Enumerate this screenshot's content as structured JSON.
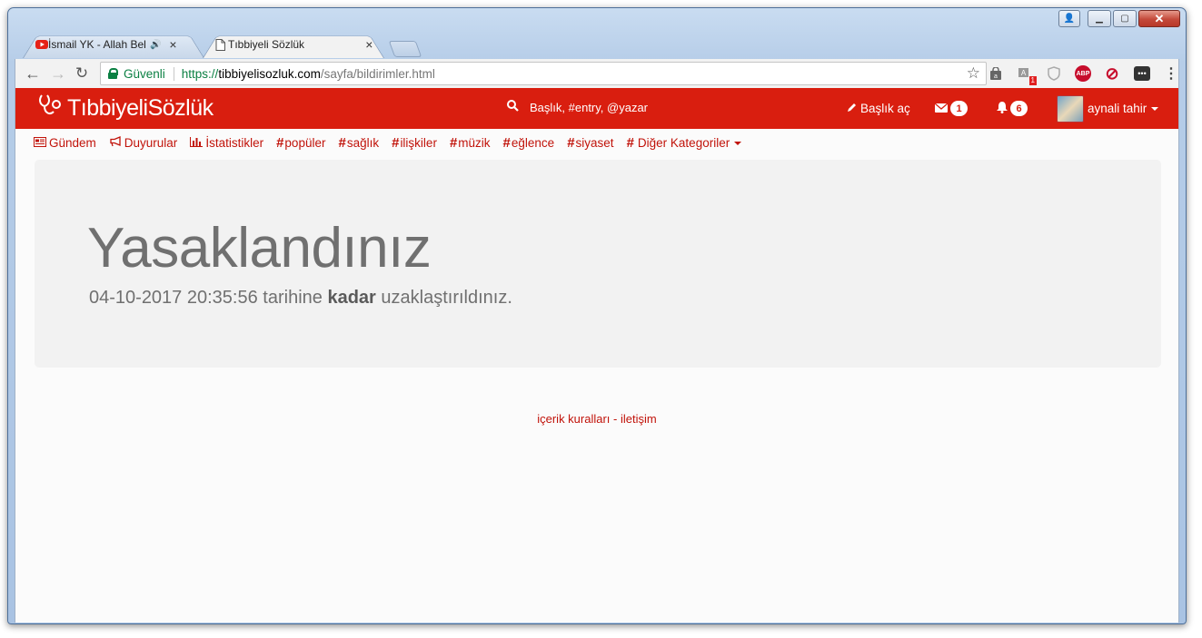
{
  "browser": {
    "tabs": [
      {
        "title": "İsmail YK - Allah Belan",
        "playing_audio": true,
        "favicon": "youtube-icon",
        "active": false
      },
      {
        "title": "Tıbbiyeli Sözlük",
        "favicon": "page-icon",
        "active": true
      }
    ],
    "close_glyph": "×",
    "audio_glyph": "🔊",
    "address": {
      "security_label": "Güvenli",
      "url_scheme": "https://",
      "url_host": "tibbiyelisozluk.com",
      "url_path": "/sayfa/bildirimler.html"
    },
    "extensions": {
      "abp_label": "ABP",
      "badge_count": "1"
    }
  },
  "site": {
    "brand_color": "#d91e0f",
    "logo": "TıbbiyeliSözlük",
    "search_placeholder": "Başlık, #entry, @yazar",
    "nav": {
      "new_topic": "Başlık aç",
      "messages_count": "1",
      "notifications_count": "6",
      "username": "aynali tahir"
    },
    "categories": [
      {
        "label": "Gündem",
        "icon": "newspaper-icon"
      },
      {
        "label": "Duyurular",
        "icon": "megaphone-icon"
      },
      {
        "label": "İstatistikler",
        "icon": "bar-chart-icon"
      },
      {
        "label": "popüler",
        "icon": "hash"
      },
      {
        "label": "sağlık",
        "icon": "hash"
      },
      {
        "label": "ilişkiler",
        "icon": "hash"
      },
      {
        "label": "müzik",
        "icon": "hash"
      },
      {
        "label": "eğlence",
        "icon": "hash"
      },
      {
        "label": "siyaset",
        "icon": "hash"
      }
    ],
    "other_categories": "Diğer Kategoriler"
  },
  "ban": {
    "title": "Yasaklandınız",
    "date": "04-10-2017 20:35:56",
    "text_before": "tarihine",
    "text_bold": "kadar",
    "text_after": "uzaklaştırıldınız."
  },
  "footer": {
    "rules_link": "içerik kuralları",
    "separator": "-",
    "contact_link": "iletişim"
  }
}
